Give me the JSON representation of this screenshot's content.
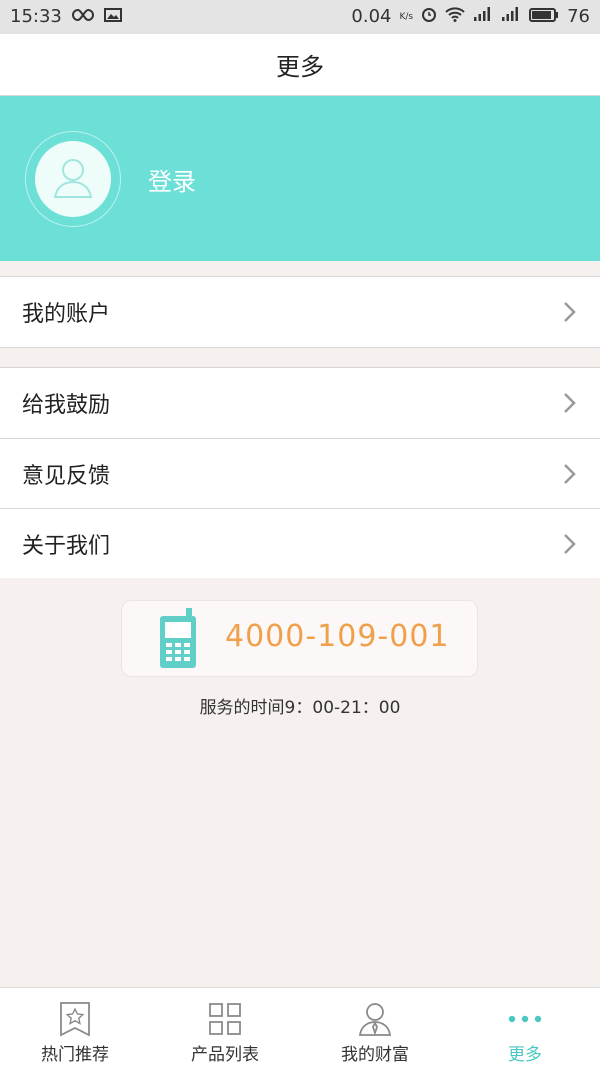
{
  "status_bar": {
    "time": "15:33",
    "net_speed": "0.04",
    "net_unit": "K/s",
    "battery": "76"
  },
  "header": {
    "title": "更多"
  },
  "profile": {
    "login_label": "登录"
  },
  "menu": {
    "account": "我的账户",
    "encourage": "给我鼓励",
    "feedback": "意见反馈",
    "about": "关于我们"
  },
  "contact": {
    "phone": "4000-109-001",
    "hours": "服务的时间9：00-21：00"
  },
  "tabs": [
    {
      "label": "热门推荐",
      "icon": "star-bookmark-icon"
    },
    {
      "label": "产品列表",
      "icon": "grid-icon"
    },
    {
      "label": "我的财富",
      "icon": "person-tie-icon"
    },
    {
      "label": "更多",
      "icon": "more-dots-icon"
    }
  ],
  "colors": {
    "accent": "#6ce0d7",
    "phone_orange": "#f0a04a",
    "active_tab": "#4cc8c2"
  }
}
